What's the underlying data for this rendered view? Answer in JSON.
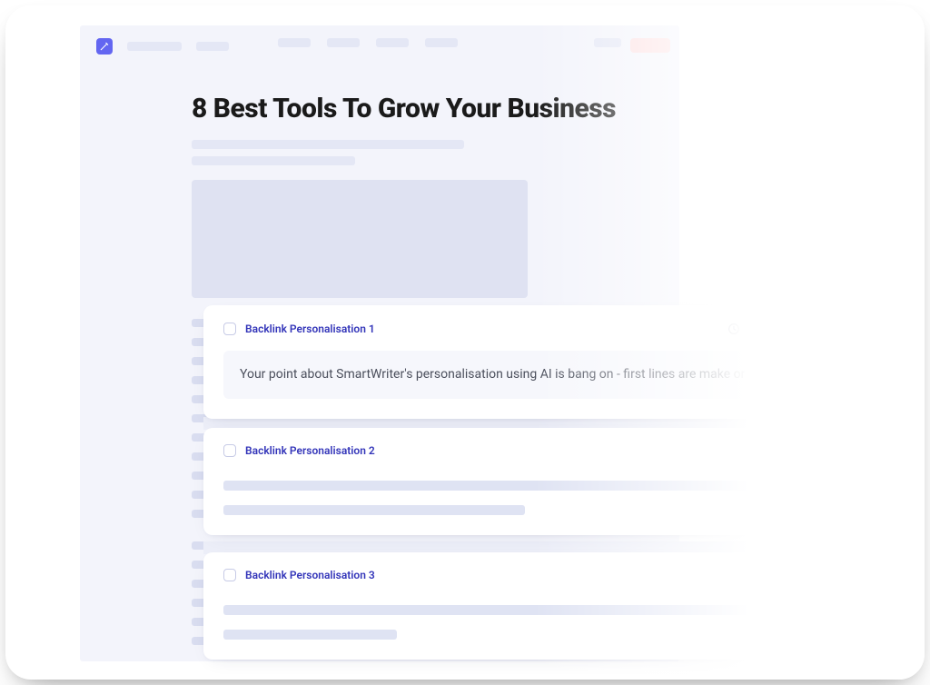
{
  "page": {
    "title": "8 Best Tools To Grow Your Business"
  },
  "cards": [
    {
      "label": "Backlink Personalisation 1",
      "text": "Your point about SmartWriter's personalisation using AI is bang on - first lines are make or break"
    },
    {
      "label": "Backlink Personalisation 2"
    },
    {
      "label": "Backlink Personalisation 3"
    }
  ],
  "actions": {
    "regenerate": "regenerate-icon",
    "download": "download-icon",
    "copy": "copy-icon"
  }
}
